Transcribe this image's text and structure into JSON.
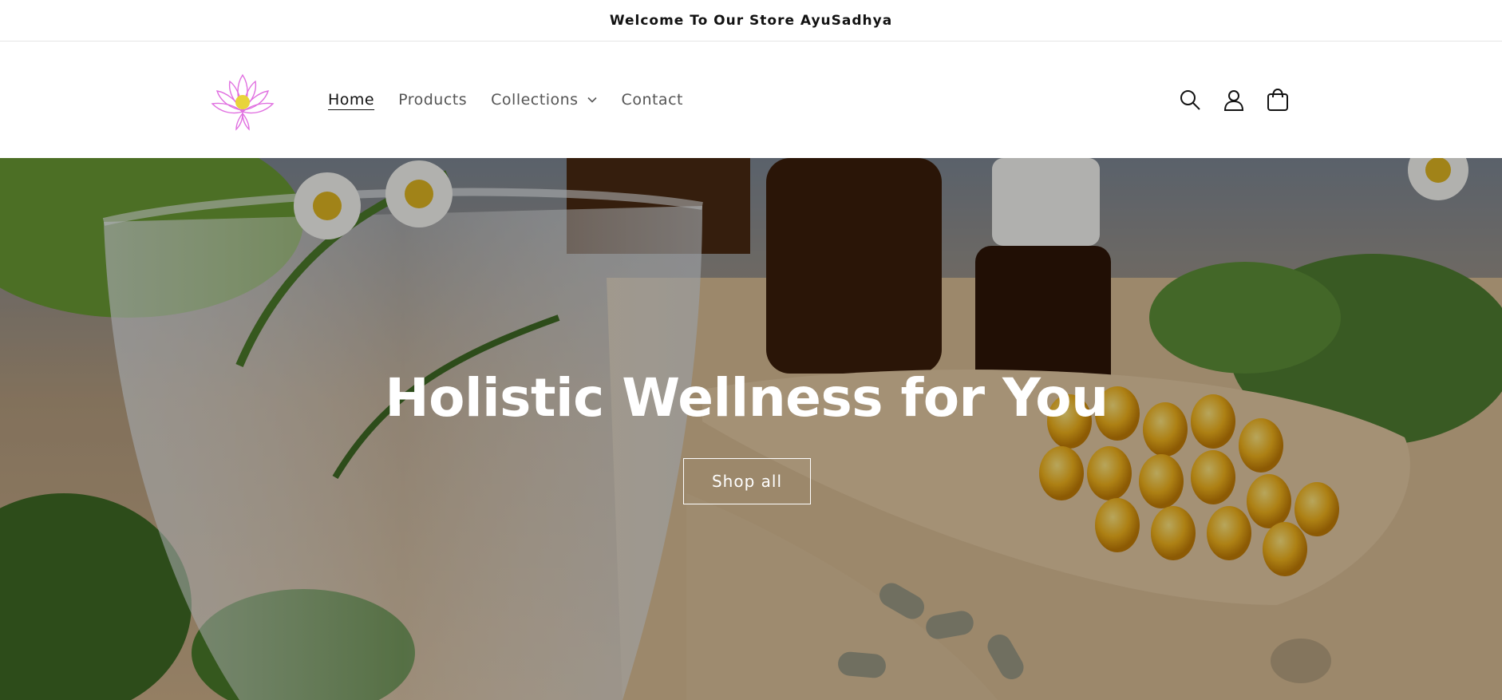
{
  "announcement": {
    "text": "Welcome To Our Store AyuSadhya"
  },
  "header": {
    "logo_icon": "lotus-logo",
    "nav": [
      {
        "label": "Home",
        "active": true
      },
      {
        "label": "Products",
        "active": false
      },
      {
        "label": "Collections",
        "active": false,
        "has_dropdown": true
      },
      {
        "label": "Contact",
        "active": false
      }
    ],
    "icons": [
      "search-icon",
      "account-icon",
      "cart-icon"
    ]
  },
  "hero": {
    "title": "Holistic Wellness for You",
    "button_label": "Shop all"
  },
  "colors": {
    "logo_pink": "#e06fe0",
    "logo_yellow": "#e8d43a",
    "text_dark": "#121212",
    "nav_muted": "#555555",
    "hero_text": "#ffffff"
  }
}
